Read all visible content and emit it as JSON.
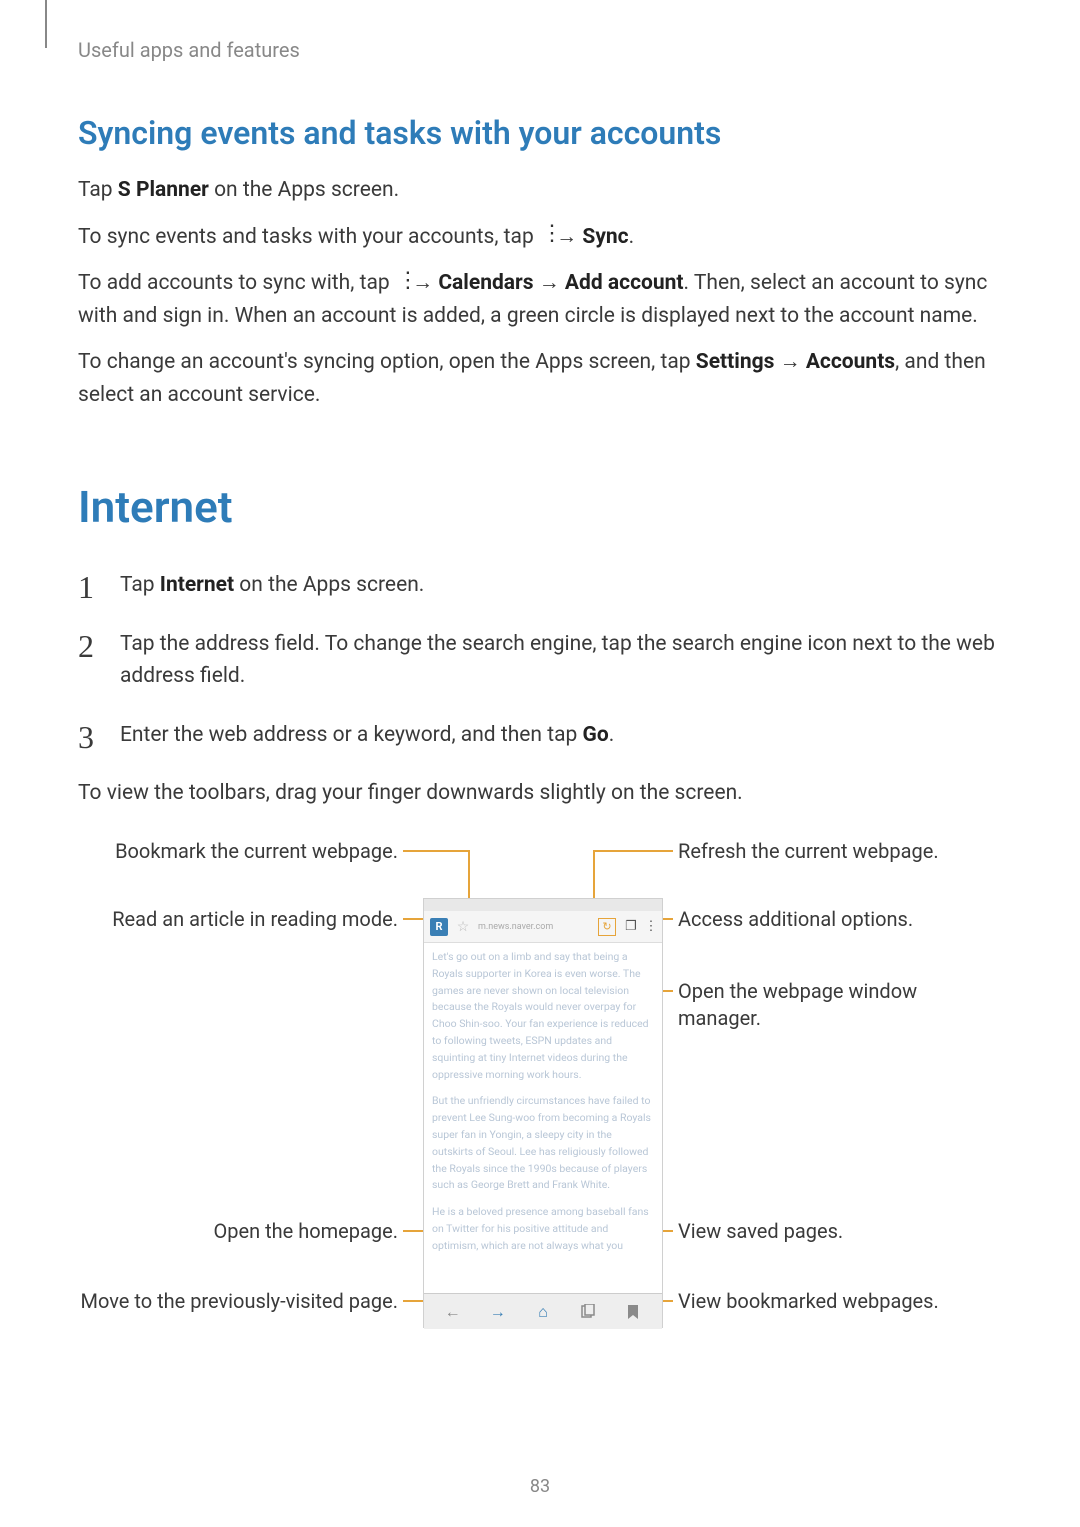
{
  "breadcrumb": "Useful apps and features",
  "section_heading": "Syncing events and tasks with your accounts",
  "p1_a": "Tap ",
  "p1_b": "S Planner",
  "p1_c": " on the Apps screen.",
  "p2_a": "To sync events and tasks with your accounts, tap ",
  "p2_b": " → ",
  "p2_c": "Sync",
  "p2_d": ".",
  "p3_a": "To add accounts to sync with, tap ",
  "p3_b": " → ",
  "p3_c": "Calendars",
  "p3_d": " → ",
  "p3_e": "Add account",
  "p3_f": ". Then, select an account to sync with and sign in. When an account is added, a green circle is displayed next to the account name.",
  "p4_a": "To change an account's syncing option, open the Apps screen, tap ",
  "p4_b": "Settings",
  "p4_c": " → ",
  "p4_d": "Accounts",
  "p4_e": ", and then select an account service.",
  "chapter_heading": "Internet",
  "steps": {
    "s1_a": "Tap ",
    "s1_b": "Internet",
    "s1_c": " on the Apps screen.",
    "s2": "Tap the address field. To change the search engine, tap the search engine icon next to the web address field.",
    "s3_a": "Enter the web address or a keyword, and then tap ",
    "s3_b": "Go",
    "s3_c": "."
  },
  "p5": "To view the toolbars, drag your finger downwards slightly on the screen.",
  "callouts": {
    "bookmark": "Bookmark the current webpage.",
    "reading": "Read an article in reading mode.",
    "homepage": "Open the homepage.",
    "back": "Move to the previously-visited page.",
    "refresh": "Refresh the current webpage.",
    "options": "Access additional options.",
    "windows": "Open the webpage window manager.",
    "saved": "View saved pages.",
    "bookmarks": "View bookmarked webpages."
  },
  "phone": {
    "url_placeholder": "m.news.naver.com",
    "body_text_1": "Let's go out on a limb and say that being a Royals supporter in Korea is even worse. The games are never shown on local television because the Royals would never overpay for Choo Shin-soo. Your fan experience is reduced to following tweets, ESPN updates and squinting at tiny Internet videos during the oppressive morning work hours.",
    "body_text_2": "But the unfriendly circumstances have failed to prevent Lee Sung-woo from becoming a Royals super fan in Yongin, a sleepy city in the outskirts of Seoul. Lee has religiously followed the Royals since the 1990s because of players such as George Brett and Frank White.",
    "body_text_3": "He is a beloved presence among baseball fans on Twitter for his positive attitude and optimism, which are not always what you"
  },
  "page_number": "83"
}
